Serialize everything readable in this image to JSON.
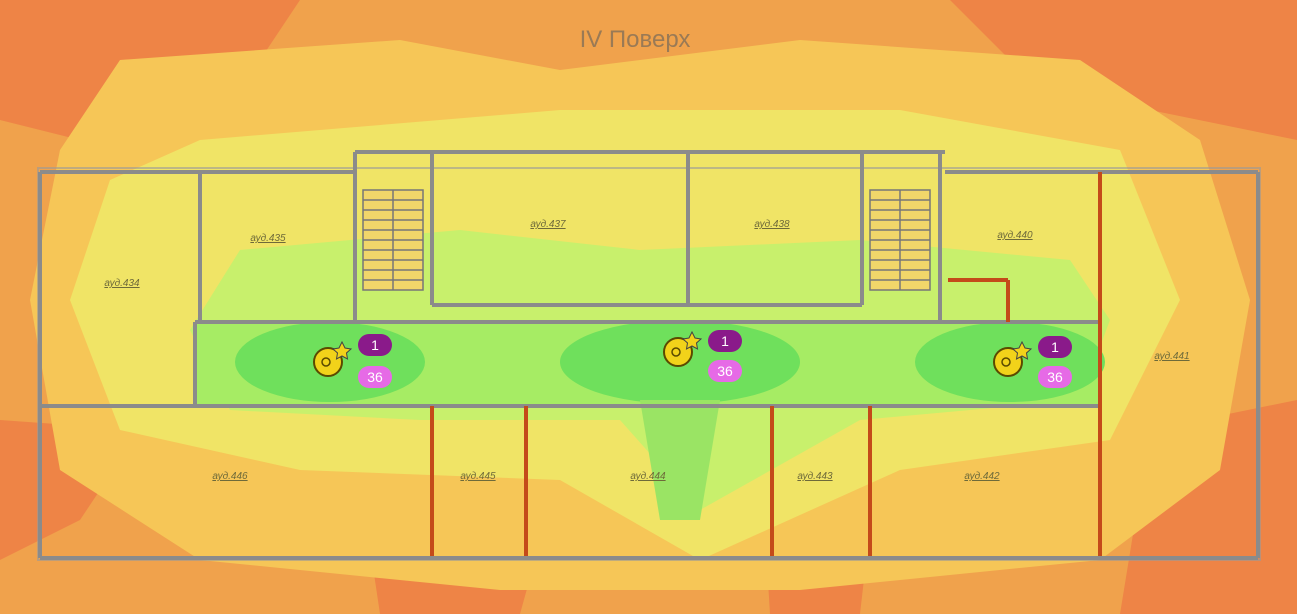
{
  "map": {
    "floor_title": "IV Поверх",
    "rooms": [
      {
        "id": "434",
        "label": "ауд.434"
      },
      {
        "id": "435",
        "label": "ауд.435"
      },
      {
        "id": "437",
        "label": "ауд.437"
      },
      {
        "id": "438",
        "label": "ауд.438"
      },
      {
        "id": "440",
        "label": "ауд.440"
      },
      {
        "id": "441",
        "label": "ауд.441"
      },
      {
        "id": "446",
        "label": "ауд.446"
      },
      {
        "id": "445",
        "label": "ауд.445"
      },
      {
        "id": "444",
        "label": "ауд.444"
      },
      {
        "id": "443",
        "label": "ауд.443"
      },
      {
        "id": "442",
        "label": "ауд.442"
      }
    ],
    "access_points": [
      {
        "channel": "1",
        "signal": "36"
      },
      {
        "channel": "1",
        "signal": "36"
      },
      {
        "channel": "1",
        "signal": "36"
      }
    ],
    "colors": {
      "strong": "#5fe05a",
      "good": "#b6f06a",
      "medium": "#eef570",
      "fair": "#f6d860",
      "weak": "#f4b24e",
      "poor": "#ec7c4a",
      "wall": "#8b8b8b",
      "barrier": "#c44a1a",
      "badge_channel": "#8a1a8a",
      "badge_signal": "#e66ae6",
      "ap_icon": "#f2d21a"
    }
  }
}
